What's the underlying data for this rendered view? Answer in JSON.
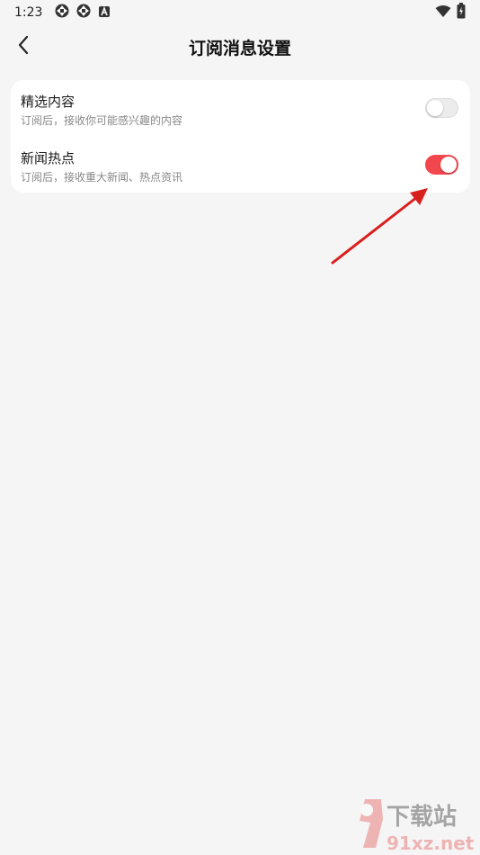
{
  "status_bar": {
    "time": "1:23",
    "left_icons": [
      "aperture-icon",
      "aperture-icon",
      "a-square-icon"
    ],
    "right_icons": [
      "wifi-icon",
      "battery-charging-icon"
    ]
  },
  "header": {
    "back_icon": "chevron-left-icon",
    "title": "订阅消息设置"
  },
  "settings": [
    {
      "title": "精选内容",
      "subtitle": "订阅后，接收你可能感兴趣的内容",
      "toggle_on": false
    },
    {
      "title": "新闻热点",
      "subtitle": "订阅后，接收重大新闻、热点资讯",
      "toggle_on": true
    }
  ],
  "colors": {
    "background": "#f5f5f5",
    "card": "#ffffff",
    "toggle_on": "#f2474d",
    "toggle_off": "#ececec",
    "annotation_arrow": "#d8201e"
  },
  "watermark": {
    "text_top": "下载站",
    "text_bottom": "91xz.net"
  }
}
